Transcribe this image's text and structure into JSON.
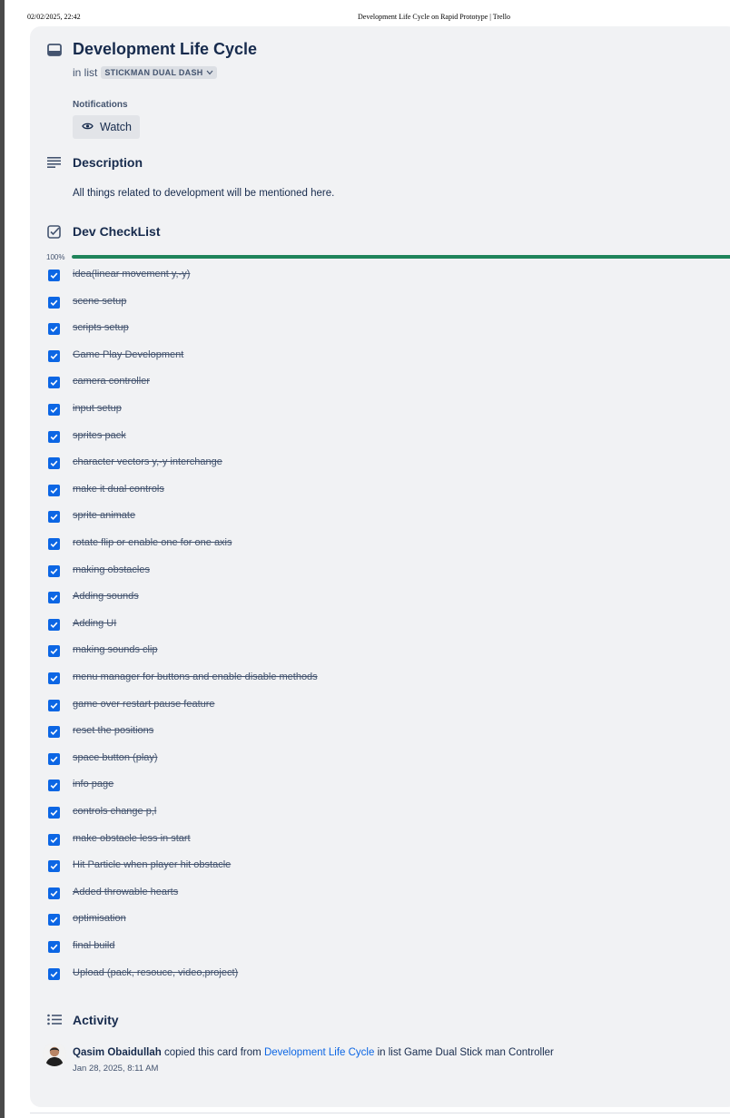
{
  "print_header": {
    "date": "02/02/2025, 22:42",
    "title": "Development Life Cycle on Rapid Prototype | Trello"
  },
  "card": {
    "title": "Development Life Cycle",
    "in_list_prefix": "in list",
    "list_name": "STICKMAN DUAL DASH",
    "icon": "card-icon"
  },
  "notifications": {
    "label": "Notifications",
    "watch_label": "Watch",
    "icon": "eye-icon"
  },
  "description": {
    "heading": "Description",
    "text": "All things related to development will be mentioned here.",
    "icon": "description-icon"
  },
  "checklist": {
    "heading": "Dev CheckList",
    "progress_label": "100%",
    "progress_percent": 100,
    "icon": "checklist-icon",
    "items": [
      "idea(linear movement y,-y)",
      "scene setup",
      "scripts setup",
      "Game Play Development",
      "camera controller",
      "input setup",
      "sprites pack",
      "character vectors y,-y interchange",
      "make it dual controls",
      "sprite animate",
      "rotate flip or enable one for one axis",
      "making obstacles",
      "Adding sounds",
      "Adding UI",
      "making sounds clip",
      "menu manager for buttons and enable disable methods",
      "game over restart pause feature",
      "reset the positions",
      "space button (play)",
      "info page",
      "controls change p,l",
      "make obstacle less in start",
      "Hit Particle when player hit obstacle",
      "Added throwable hearts",
      "optimisation",
      "final build",
      "Upload (pack, resouce, video,project)"
    ]
  },
  "activity": {
    "heading": "Activity",
    "icon": "activity-icon",
    "entry": {
      "user": "Qasim Obaidullah",
      "action": "copied this card from",
      "link": "Development Life Cycle",
      "suffix": "in list Game Dual Stick man Controller",
      "time": "Jan 28, 2025, 8:11 AM"
    }
  },
  "colors": {
    "background": "#f1f2f4",
    "text": "#172b4d",
    "checkbox": "#0c66e4",
    "progress": "#1f845a",
    "link": "#0c66e4"
  }
}
